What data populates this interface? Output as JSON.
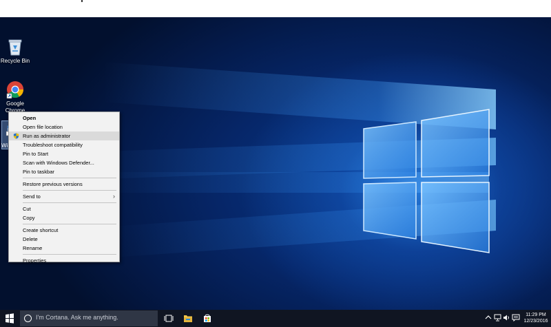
{
  "desktop": {
    "icons": [
      {
        "label": "Recycle Bin",
        "icon": "recycle-bin-icon"
      },
      {
        "label": "Google Chrome",
        "icon": "chrome-icon"
      },
      {
        "label": "Wi",
        "icon": "application-icon"
      }
    ]
  },
  "context_menu": {
    "items": [
      {
        "label": "Open",
        "bold": true
      },
      {
        "label": "Open file location"
      },
      {
        "label": "Run as administrator",
        "icon": "uac-shield-icon",
        "highlighted": true
      },
      {
        "label": "Troubleshoot compatibility"
      },
      {
        "label": "Pin to Start"
      },
      {
        "label": "Scan with Windows Defender..."
      },
      {
        "label": "Pin to taskbar"
      },
      {
        "label": "Restore previous versions"
      },
      {
        "label": "Send to",
        "submenu": true
      },
      {
        "label": "Cut"
      },
      {
        "label": "Copy"
      },
      {
        "label": "Create shortcut"
      },
      {
        "label": "Delete"
      },
      {
        "label": "Rename"
      },
      {
        "label": "Properties"
      }
    ]
  },
  "taskbar": {
    "search_placeholder": "I'm Cortana. Ask me anything.",
    "apps": [
      "task-view-icon",
      "file-explorer-icon",
      "store-icon"
    ],
    "clock": {
      "time": "11:29 PM",
      "date": "12/23/2016"
    }
  },
  "colors": {
    "desktop_dark": "#041a4a",
    "desktop_glow": "#2882e6",
    "taskbar": "#101522",
    "menu_bg": "#f2f2f2",
    "menu_highlight": "#dadada"
  }
}
